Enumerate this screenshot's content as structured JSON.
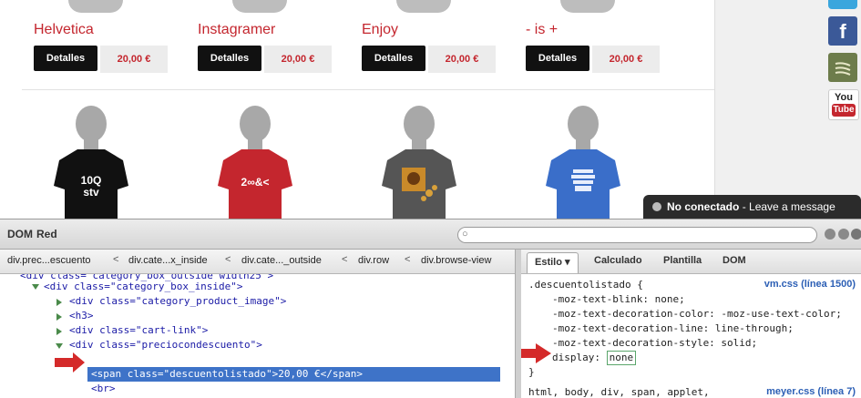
{
  "products_top": [
    {
      "name": "Helvetica",
      "button": "Detalles",
      "price": "20,00 €"
    },
    {
      "name": "Instagramer",
      "button": "Detalles",
      "price": "20,00 €"
    },
    {
      "name": "Enjoy",
      "button": "Detalles",
      "price": "20,00 €"
    },
    {
      "name": "- is +",
      "button": "Detalles",
      "price": "20,00 €"
    }
  ],
  "shirts": [
    {
      "color": "#111111",
      "text": "10Q\nstv",
      "line1": "10Q",
      "line2": "stv"
    },
    {
      "color": "#c4262e",
      "line1": "2∞&<",
      "line2": ""
    },
    {
      "color": "#555555",
      "line1": "",
      "line2": ""
    },
    {
      "color": "#3a6ec9",
      "line1": "",
      "line2": ""
    }
  ],
  "social": [
    {
      "icon": "twitter-icon",
      "color": "#3aa6dd"
    },
    {
      "icon": "facebook-icon",
      "color": "#3b5998",
      "label": "f"
    },
    {
      "icon": "rss-icon",
      "color": "#6d7c4b"
    },
    {
      "icon": "youtube-icon",
      "color": "#ffffff",
      "label": "You Tube"
    }
  ],
  "chat": {
    "status": "No conectado",
    "message": "- Leave a message"
  },
  "devtools": {
    "toolbar": {
      "dom_label": "DOM",
      "net_label": "Red",
      "search_placeholder": ""
    },
    "breadcrumbs": [
      "div.prec...escuento",
      "div.cate...x_inside",
      "div.cate..._outside",
      "div.row",
      "div.browse-view"
    ],
    "tree": [
      {
        "text": "<div class=\"category_box_outside width25\">"
      },
      {
        "text": "<div class=\"category_box_inside\">"
      },
      {
        "text": "<div class=\"category_product_image\">"
      },
      {
        "text": "<h3>"
      },
      {
        "text": "<div class=\"cart-link\">"
      },
      {
        "text": "<div class=\"preciocondescuento\">"
      },
      {
        "text": "<span class=\"descuentolistado\">20,00 €</span>"
      },
      {
        "text": "<br>"
      }
    ],
    "right_tabs": [
      "Estilo",
      "Calculado",
      "Plantilla",
      "DOM"
    ],
    "css_rules": {
      "selector": ".descuentolistado {",
      "source": "vm.css (línea 1500)",
      "props": [
        "-moz-text-blink: none;",
        "-moz-text-decoration-color: -moz-use-text-color;",
        "-moz-text-decoration-line: line-through;",
        "-moz-text-decoration-style: solid;"
      ],
      "display_prop": "display:",
      "display_value": "none",
      "close": "}",
      "next_selector": "html, body, div, span, applet,",
      "next_source": "meyer.css (línea 7)"
    }
  }
}
